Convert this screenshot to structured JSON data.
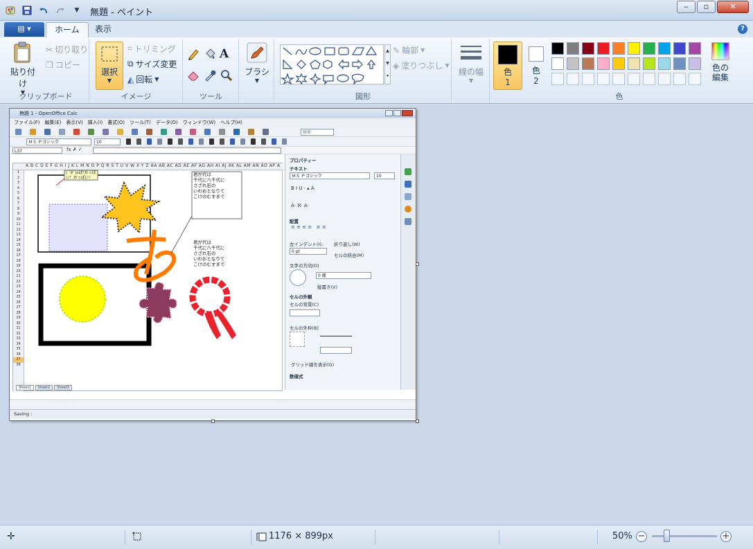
{
  "window": {
    "title": "無題 - ペイント",
    "buttons": [
      "minimize",
      "maximize",
      "close"
    ]
  },
  "tabs": {
    "app_menu": "▤ ▾",
    "home": "ホーム",
    "view": "表示"
  },
  "ribbon": {
    "clipboard": {
      "label": "クリップボード",
      "paste": "貼り付け",
      "cut": "切り取り",
      "copy": "コピー"
    },
    "image": {
      "label": "イメージ",
      "select": "選択",
      "crop": "トリミング",
      "resize": "サイズ変更",
      "rotate": "回転"
    },
    "tools": {
      "label": "ツール"
    },
    "brushes": {
      "label": "ブラシ"
    },
    "shapes": {
      "label": "図形",
      "outline": "輪郭",
      "fill": "塗りつぶし"
    },
    "size": {
      "label": "線の幅"
    },
    "colors": {
      "label": "色",
      "color1_label": "色",
      "color1_num": "1",
      "color2_label": "色",
      "color2_num": "2",
      "edit_label": "色の編集",
      "color1": "#000000",
      "color2": "#ffffff",
      "palette_row1": [
        "#000000",
        "#7f7f7f",
        "#880015",
        "#ed1c24",
        "#ff7f27",
        "#fff200",
        "#22b14c",
        "#00a2e8",
        "#3f48cc",
        "#a349a4"
      ],
      "palette_row2": [
        "#ffffff",
        "#c3c3c3",
        "#b97a57",
        "#ffaec9",
        "#ffc90e",
        "#efe4b0",
        "#b5e61d",
        "#99d9ea",
        "#7092be",
        "#c8bfe7"
      ]
    }
  },
  "canvas_content": {
    "oo_title": "無題 1 - OpenOffice Calc",
    "oo_menu": [
      "ファイル(F)",
      "編集(E)",
      "表示(V)",
      "挿入(I)",
      "書式(O)",
      "ツール(T)",
      "データ(D)",
      "ウィンドウ(W)",
      "ヘルプ(H)"
    ],
    "font_name": "ＭＳ Ｐゴシック",
    "font_size": "10",
    "cell_ref": "L37",
    "search_placeholder": "検索",
    "columns": "A B C D E F G H I J K L M N O P Q R S T U V W X Y Z AA AB AC AD AE AF AG AH AI AJ AK AL AM AN AO AP A",
    "callout": "( ´∀`)oぱ*おっぱ\nい！おっぱい！",
    "poem1": "君が代は\n千代に八千代に\nさざれ石の\nいわおとなりて\nこけのむすまで",
    "poem2": "君が代は\n千代に八千代に\nさざれ石の\nいわおとなりて\nこけのむすまで",
    "hiragana": "あ",
    "props_title": "プロパティー",
    "props_text": "テキスト",
    "props_font": "ＭＳ Ｐゴシック",
    "props_size": "10",
    "props_align": "配置",
    "props_indent": "左インデント(I):",
    "props_indent_val": "0 pt",
    "props_wrap": "折り返し(W)",
    "props_merge": "セルの結合(M)",
    "props_direction": "文字の方向(O)",
    "props_degree": "0 度",
    "props_vertical": "縦書き(V)",
    "props_cellborder": "セルの外観",
    "props_bg": "セルの背景(C)",
    "props_border": "セルの外枠(B)",
    "props_grid": "グリッド線を表示(G)",
    "props_number": "数値式",
    "sheet_tabs": [
      "Sheet1",
      "Sheet2",
      "Sheet3"
    ],
    "oo_status": "Saving :"
  },
  "status": {
    "canvas_size": "1176 × 899px",
    "zoom": "50%",
    "zoom_fraction": 0.27
  }
}
